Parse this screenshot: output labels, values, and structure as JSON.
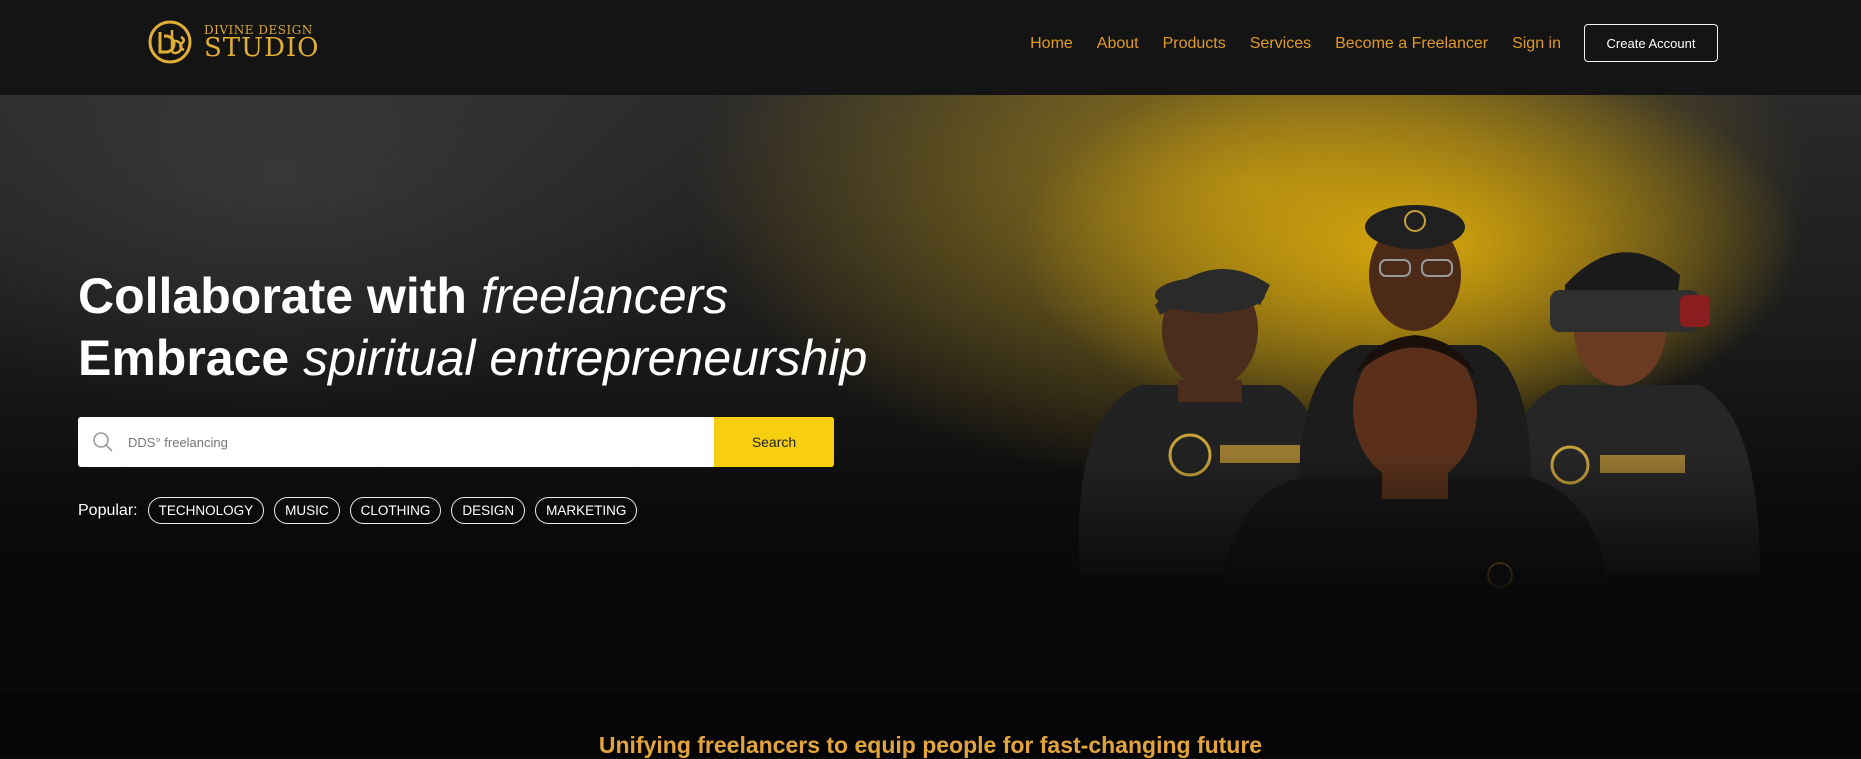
{
  "brand": {
    "name_line1": "DIVINE DESIGN",
    "name_line2": "STUDIO",
    "gold": "#e0ae35"
  },
  "nav": {
    "items": [
      {
        "label": "Home"
      },
      {
        "label": "About"
      },
      {
        "label": "Products"
      },
      {
        "label": "Services"
      },
      {
        "label": "Become a Freelancer"
      },
      {
        "label": "Sign in"
      }
    ],
    "cta_label": "Create Account",
    "link_color": "#e09a22"
  },
  "hero": {
    "line1_bold": "Collaborate with",
    "line1_italic": "freelancers",
    "line2_bold": "Embrace",
    "line2_italic": "spiritual entrepreneurship",
    "search": {
      "placeholder": "DDS° freelancing",
      "button_label": "Search",
      "button_color": "#f7cf0f"
    },
    "popular": {
      "label": "Popular:",
      "tags": [
        "TECHNOLOGY",
        "MUSIC",
        "CLOTHING",
        "DESIGN",
        "MARKETING"
      ]
    }
  },
  "band": {
    "tagline": "Unifying freelancers to equip people for fast-changing future",
    "tagline_color": "#e3a43b"
  }
}
